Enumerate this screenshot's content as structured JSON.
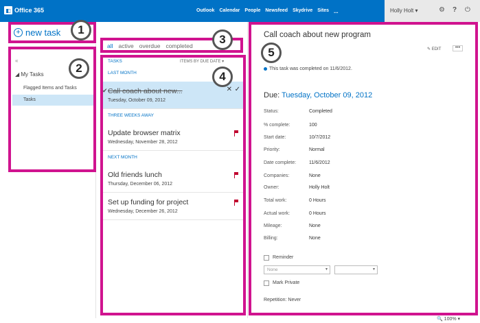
{
  "topbar": {
    "brand": "Office 365",
    "nav": [
      "Outlook",
      "Calendar",
      "People",
      "Newsfeed",
      "Skydrive",
      "Sites"
    ],
    "more": "...",
    "user": "Holly Holt",
    "icons": [
      "gear-icon",
      "help-icon",
      "power-icon"
    ],
    "colors": {
      "bar": "#0072c6",
      "accent": "#0072c6",
      "callout": "#d0138f"
    }
  },
  "left": {
    "new_task": "new task",
    "collapse": "«",
    "tree_root": "My Tasks",
    "items": [
      {
        "label": "Flagged Items and Tasks",
        "selected": false
      },
      {
        "label": "Tasks",
        "selected": true
      }
    ]
  },
  "filters": {
    "all": "all",
    "active": "active",
    "overdue": "overdue",
    "completed": "completed"
  },
  "list": {
    "header": "TASKS",
    "sort": "ITEMS BY DUE DATE",
    "groups": [
      "LAST MONTH",
      "THREE WEEKS AWAY",
      "NEXT MONTH"
    ],
    "tasks": [
      {
        "title": "Call coach about new...",
        "date": "Tuesday, October 09, 2012",
        "completed": true,
        "selected": true
      },
      {
        "title": "Update browser matrix",
        "date": "Wednesday, November 28, 2012",
        "completed": false,
        "selected": false
      },
      {
        "title": "Old friends lunch",
        "date": "Thursday, December 06, 2012",
        "completed": false,
        "selected": false
      },
      {
        "title": "Set up funding for project",
        "date": "Wednesday, December 26, 2012",
        "completed": false,
        "selected": false
      }
    ]
  },
  "detail": {
    "title": "Call coach about new program",
    "edit": "EDIT",
    "more": "•••",
    "completed_note": "This task was completed on 11/6/2012.",
    "due_label": "Due:",
    "due_value": "Tuesday, October 09, 2012",
    "fields": [
      {
        "label": "Status:",
        "value": "Completed"
      },
      {
        "label": "% complete:",
        "value": "100"
      },
      {
        "label": "Start date:",
        "value": "10/7/2012"
      },
      {
        "label": "Priority:",
        "value": "Normal"
      },
      {
        "label": "Date complete:",
        "value": "11/6/2012"
      },
      {
        "label": "Companies:",
        "value": "None"
      },
      {
        "label": "Owner:",
        "value": "Holly Holt"
      },
      {
        "label": "Total work:",
        "value": "0 Hours"
      },
      {
        "label": "Actual work:",
        "value": "0 Hours"
      },
      {
        "label": "Mileage:",
        "value": "None"
      },
      {
        "label": "Billing:",
        "value": "None"
      }
    ],
    "reminder": "Reminder",
    "reminder_select": "None",
    "mark_private": "Mark Private",
    "repetition": "Repetition: Never"
  },
  "callouts": [
    "1",
    "2",
    "3",
    "4",
    "5"
  ],
  "status": {
    "zoom": "100%"
  }
}
